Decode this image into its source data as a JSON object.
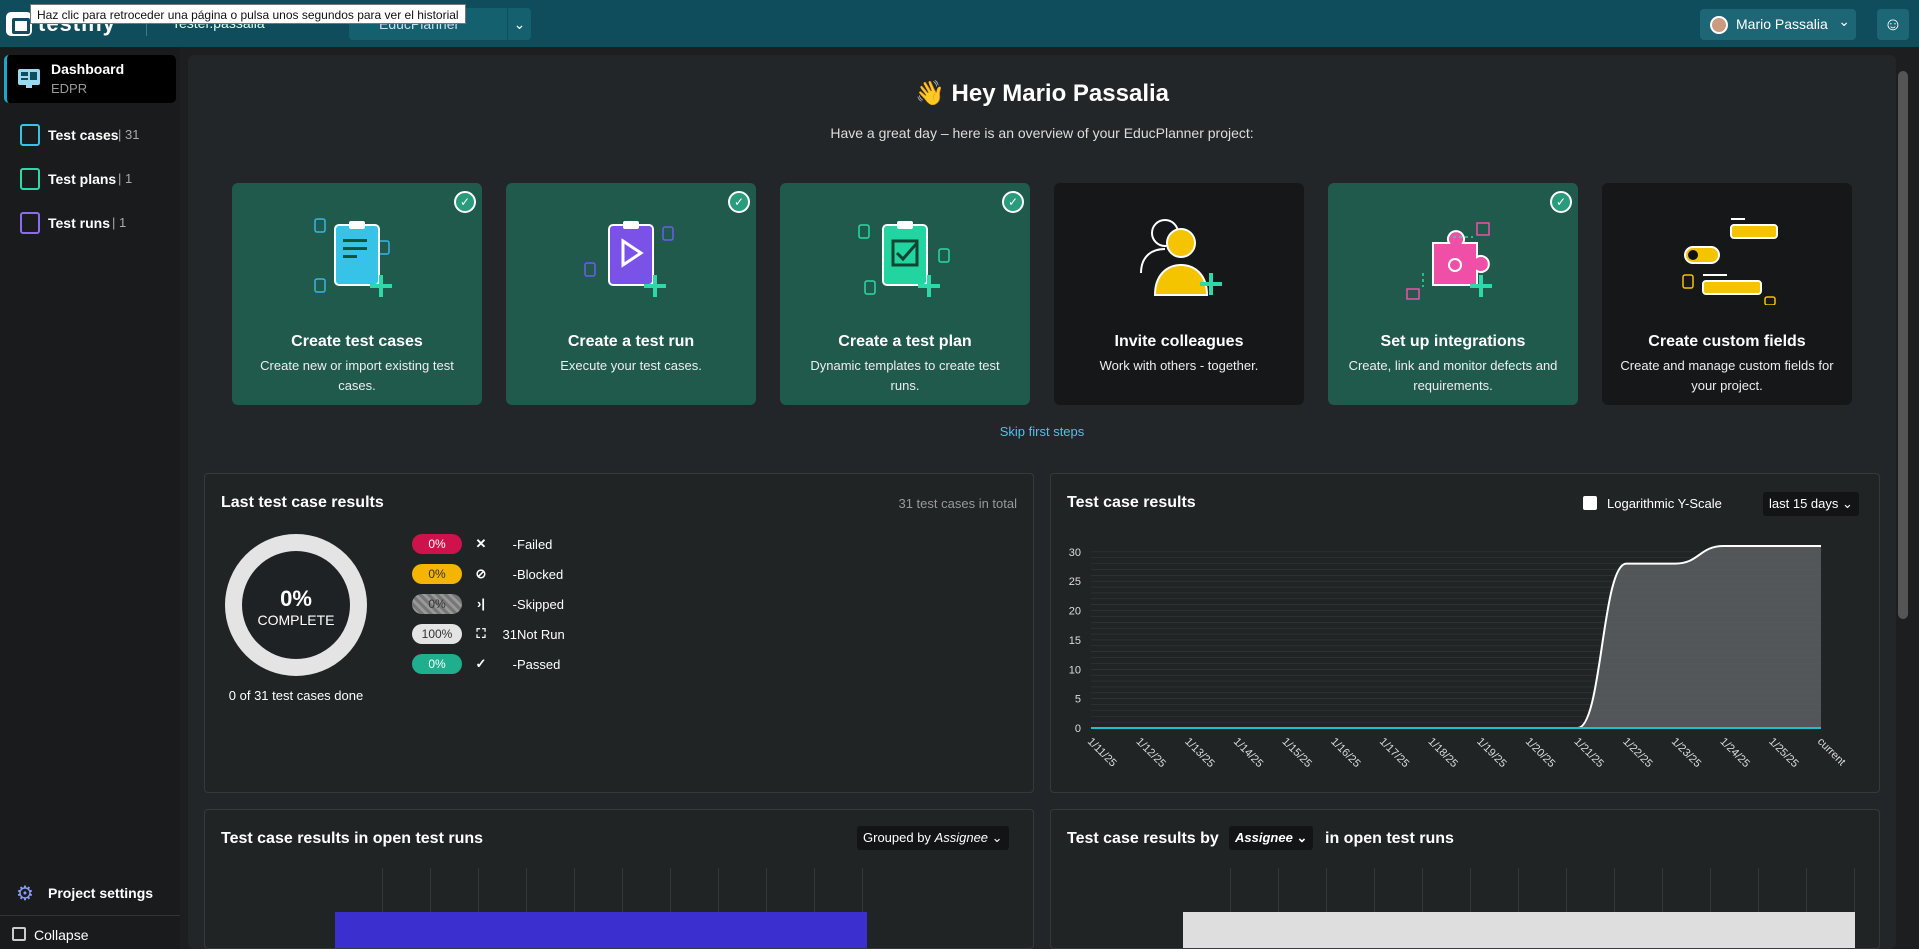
{
  "tooltip": "Haz clic para retroceder una página o pulsa unos segundos para ver el historial",
  "app": {
    "name": "testiny"
  },
  "header": {
    "user_label": "Tester.passalia",
    "project": "EducPlanner",
    "account_name": "Mario Passalia"
  },
  "sidebar": {
    "dashboard": {
      "label": "Dashboard",
      "sub": "EDPR"
    },
    "items": [
      {
        "label": "Test cases",
        "count": "31"
      },
      {
        "label": "Test plans",
        "count": "1"
      },
      {
        "label": "Test runs",
        "count": "1"
      }
    ],
    "settings": "Project settings",
    "collapse": "Collapse"
  },
  "greeting": {
    "emoji": "👋",
    "title": "Hey Mario Passalia",
    "subtitle": "Have a great day – here is an overview of your EducPlanner project:"
  },
  "cards": [
    {
      "title": "Create test cases",
      "desc": "Create new or import existing test cases.",
      "done": true
    },
    {
      "title": "Create a test run",
      "desc": "Execute your test cases.",
      "done": true
    },
    {
      "title": "Create a test plan",
      "desc": "Dynamic templates to create test runs.",
      "done": true
    },
    {
      "title": "Invite colleagues",
      "desc": "Work with others - together.",
      "done": false
    },
    {
      "title": "Set up integrations",
      "desc": "Create, link and monitor defects and requirements.",
      "done": true
    },
    {
      "title": "Create custom fields",
      "desc": "Create and manage custom fields for your project.",
      "done": false
    }
  ],
  "skip": "Skip first steps",
  "last_results": {
    "title": "Last test case results",
    "total": "31 test cases in total",
    "donut_pct": "0%",
    "donut_label": "COMPLETE",
    "done_text": "0 of 31 test cases done",
    "statuses": [
      {
        "pct": "0%",
        "icon": "✕",
        "count": "-",
        "label": "Failed",
        "color": "#d0124c"
      },
      {
        "pct": "0%",
        "icon": "⊘",
        "count": "-",
        "label": "Blocked",
        "color": "#f5b400"
      },
      {
        "pct": "0%",
        "icon": "›|",
        "count": "-",
        "label": "Skipped",
        "color": "#8a8a8a"
      },
      {
        "pct": "100%",
        "icon": "⛶",
        "count": "31",
        "label": "Not Run",
        "color": "#e4e4e4"
      },
      {
        "pct": "0%",
        "icon": "✓",
        "count": "-",
        "label": "Passed",
        "color": "#1fae8e"
      }
    ]
  },
  "chart_panel": {
    "title": "Test case results",
    "log_label": "Logarithmic Y-Scale",
    "range": "last 15 days"
  },
  "chart_data": {
    "type": "area",
    "categories": [
      "1/11/25",
      "1/12/25",
      "1/13/25",
      "1/14/25",
      "1/15/25",
      "1/16/25",
      "1/17/25",
      "1/18/25",
      "1/19/25",
      "1/20/25",
      "1/21/25",
      "1/22/25",
      "1/23/25",
      "1/24/25",
      "1/25/25",
      "current"
    ],
    "series": [
      {
        "values": [
          0,
          0,
          0,
          0,
          0,
          0,
          0,
          0,
          0,
          0,
          0,
          28,
          28,
          31,
          31,
          31
        ]
      },
      {
        "values": [
          0,
          0,
          0,
          0,
          0,
          0,
          0,
          0,
          0,
          0,
          0,
          0,
          0,
          0,
          0,
          0
        ]
      }
    ],
    "yticks": [
      0,
      5,
      10,
      15,
      20,
      25,
      30
    ],
    "ylim": [
      0,
      31
    ]
  },
  "open_runs": {
    "title": "Test case results in open test runs",
    "grouped_prefix": "Grouped by",
    "grouped_value": "Assignee"
  },
  "by_assignee": {
    "title_prefix": "Test case results by",
    "select": "Assignee",
    "title_suffix": "in open test runs"
  },
  "colors": {
    "accent": "#1aa7c8",
    "header": "#0f4d5c",
    "done_card": "#1f5a4d"
  }
}
